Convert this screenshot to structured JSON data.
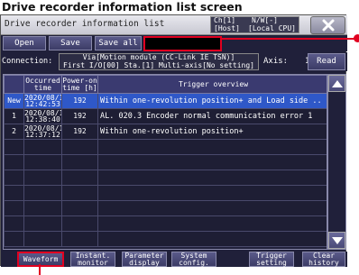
{
  "heading": "Drive recorder information list screen",
  "titlebar": {
    "title": "Drive recorder information list",
    "ch": "Ch[1]",
    "nw": "N/W[-]",
    "host": "[Host]",
    "cpu": "[Local CPU]",
    "close_label": "✖"
  },
  "toolbar": {
    "open_label": "Open",
    "save_label": "Save",
    "save_all_label": "Save all"
  },
  "connection": {
    "label": "Connection:",
    "line1": "Via[Motion module (CC-Link IE TSN)]",
    "line2": "First I/O[00] Sta.[1] Multi-axis[No setting]",
    "axis_label": "Axis:",
    "axis_value": "1",
    "read_label": "Read"
  },
  "table": {
    "headers": [
      "",
      "Occurred time",
      "Power-on time [h]",
      "Trigger overview"
    ],
    "rows": [
      {
        "no": "New",
        "date": "2020/08/18",
        "time": "12:42:53",
        "power": "192",
        "overview": "Within one-revolution position+ and Load side .."
      },
      {
        "no": "1",
        "date": "2020/08/18",
        "time": "12:38:40",
        "power": "192",
        "overview": "AL. 020.3 Encoder normal communication error 1"
      },
      {
        "no": "2",
        "date": "2020/08/18",
        "time": "12:37:12",
        "power": "192",
        "overview": "Within one-revolution position+"
      }
    ]
  },
  "footer": {
    "waveform": "Waveform",
    "instant": "Instant.\nmonitor",
    "param": "Parameter\ndisplay",
    "system": "System\nconfig.",
    "trigger": "Trigger\nsetting",
    "clear": "Clear\nhistory"
  },
  "colors": {
    "accent": "#e10020",
    "selected_row": "#2f58c8",
    "screen_bg": "#20203a"
  }
}
